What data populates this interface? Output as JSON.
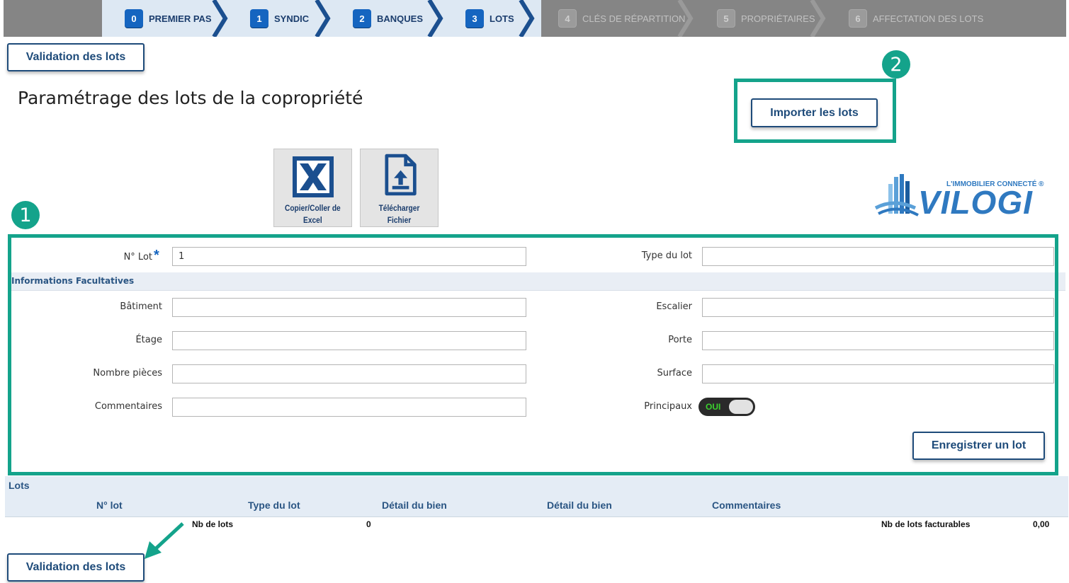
{
  "steps": [
    {
      "num": "0",
      "label": "PREMIER PAS"
    },
    {
      "num": "1",
      "label": "SYNDIC"
    },
    {
      "num": "2",
      "label": "BANQUES"
    },
    {
      "num": "3",
      "label": "LOTS"
    },
    {
      "num": "4",
      "label": "CLÉS DE RÉPARTITION"
    },
    {
      "num": "5",
      "label": "PROPRIÉTAIRES"
    },
    {
      "num": "6",
      "label": "AFFECTATION DES LOTS"
    }
  ],
  "header": {
    "validate_label": "Validation des lots",
    "page_title": "Paramétrage des lots de la copropriété",
    "import_label": "Importer les lots"
  },
  "annotations": {
    "one": "1",
    "two": "2"
  },
  "tiles": {
    "excel_label_1": "Copier/Coller de",
    "excel_label_2": "Excel",
    "upload_label": "Télécharger Fichier"
  },
  "logo": {
    "tagline": "L'IMMOBILIER CONNECTÉ ®",
    "name": "VILOGI"
  },
  "form": {
    "lot_label": "N° Lot",
    "lot_required": "*",
    "lot_value": "1",
    "type_label": "Type du lot",
    "type_value": "",
    "section_title": "Informations Facultatives",
    "batiment_label": "Bâtiment",
    "escalier_label": "Escalier",
    "etage_label": "Étage",
    "porte_label": "Porte",
    "pieces_label": "Nombre pièces",
    "surface_label": "Surface",
    "commentaires_label": "Commentaires",
    "principaux_label": "Principaux",
    "principaux_toggle": "OUI",
    "principaux_on": true,
    "save_label": "Enregistrer un lot"
  },
  "table": {
    "title": "Lots",
    "columns": [
      "N° lot",
      "Type du lot",
      "Détail du bien",
      "Détail du bien",
      "Commentaires"
    ],
    "nb_lots_label": "Nb de lots",
    "nb_lots_value": "0",
    "nb_facturables_label": "Nb de lots facturables",
    "nb_facturables_value": "0,00"
  },
  "footer": {
    "validate_label": "Validation des lots"
  },
  "colors": {
    "accent": "#1565c0",
    "annotation": "#14a38b",
    "navy": "#1e4b7a"
  }
}
